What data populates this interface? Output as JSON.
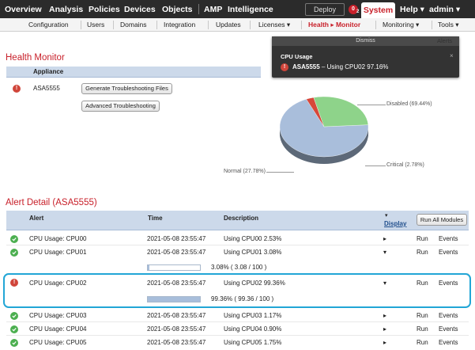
{
  "nav": {
    "main": [
      "Overview",
      "Analysis",
      "Policies",
      "Devices",
      "Objects",
      "AMP",
      "Intelligence"
    ],
    "deploy": "Deploy",
    "notifications": "0",
    "notification_count": "2",
    "system": "System",
    "help": "Help ▾",
    "user": "admin ▾"
  },
  "subnav": {
    "items": [
      "Configuration",
      "Users",
      "Domains",
      "Integration",
      "Updates",
      "Licenses ▾",
      "Health ▸ Monitor",
      "Monitoring ▾",
      "Tools ▾"
    ]
  },
  "health": {
    "title": "Health Monitor",
    "appliance_header": "Appliance",
    "appliance": "ASA5555",
    "btn_generate": "Generate Troubleshooting Files",
    "btn_advanced": "Advanced Troubleshooting"
  },
  "toast": {
    "dismiss": "Dismiss",
    "title": "CPU Usage",
    "device": "ASA5555",
    "message": "– Using CPU02 97.16%",
    "alerts_tab": "Alerts"
  },
  "chart_data": {
    "type": "pie",
    "slices": [
      {
        "label": "Disabled (69.44%)",
        "value": 69.44,
        "color": "#a9bedb"
      },
      {
        "label": "Critical (2.78%)",
        "value": 2.78,
        "color": "#d7473a"
      },
      {
        "label": "Normal (27.78%)",
        "value": 27.78,
        "color": "#8ed38a"
      }
    ]
  },
  "alerts": {
    "title": "Alert Detail (ASA5555)",
    "headers": {
      "alert": "Alert",
      "time": "Time",
      "description": "Description",
      "display_arrow": "▾",
      "display": "Display"
    },
    "run_all": "Run All Modules",
    "run": "Run",
    "events": "Events",
    "rows": [
      {
        "alert": "CPU Usage: CPU00",
        "time": "2021-05-08 23:55:47",
        "desc": "Using CPU00 2.53%",
        "status": "ok",
        "arrow": "▸"
      },
      {
        "alert": "CPU Usage: CPU01",
        "time": "2021-05-08 23:55:47",
        "desc": "Using CPU01 3.08%",
        "status": "ok",
        "arrow": "▾",
        "bar_value": 3.08,
        "bar_text": "3.08% ( 3.08 / 100 )"
      },
      {
        "alert": "CPU Usage: CPU02",
        "time": "2021-05-08 23:55:47",
        "desc": "Using CPU02 99.36%",
        "status": "critical",
        "arrow": "▾",
        "bar_value": 99.36,
        "bar_text": "99.36% ( 99.36 / 100 )"
      },
      {
        "alert": "CPU Usage: CPU03",
        "time": "2021-05-08 23:55:47",
        "desc": "Using CPU03 1.17%",
        "status": "ok",
        "arrow": "▸"
      },
      {
        "alert": "CPU Usage: CPU04",
        "time": "2021-05-08 23:55:47",
        "desc": "Using CPU04 0.90%",
        "status": "ok",
        "arrow": "▸"
      },
      {
        "alert": "CPU Usage: CPU05",
        "time": "2021-05-08 23:55:47",
        "desc": "Using CPU05 1.75%",
        "status": "ok",
        "arrow": "▸"
      }
    ]
  }
}
